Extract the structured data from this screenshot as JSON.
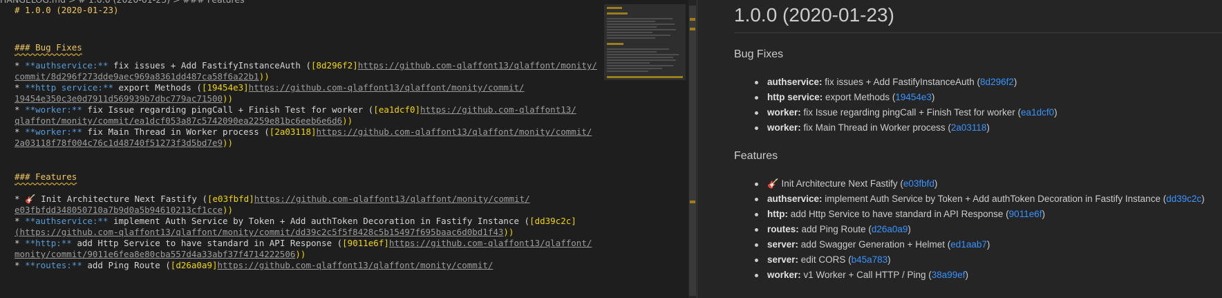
{
  "breadcrumb": "HANGELOG.md > # 1.0.0 (2020-01-23) > ### Features",
  "editor": {
    "h1": "# 1.0.0 (2020-01-23)",
    "bugfix_heading": "### Bug Fixes",
    "features_heading": "### Features",
    "bugfixes": [
      {
        "line1": {
          "bullet": "* ",
          "bold": "**authservice:**",
          "text": " fix issues + Add FastifyInstanceAuth (",
          "link": "[8d296f2]",
          "url": "https://github.com-qlaffont13/qlaffont/monity/"
        },
        "line2": {
          "url": "commit/8d296f273dde9aec969a8361dd487ca58f6a22b1",
          "close": "))"
        }
      },
      {
        "line1": {
          "bullet": "* ",
          "bold": "**http service:**",
          "text": " export Methods (",
          "link": "[19454e3]",
          "url": "https://github.com-qlaffont13/qlaffont/monity/commit/"
        },
        "line2": {
          "url": "19454e350c3e0d7911d569939b7dbc779ac71500",
          "close": "))"
        }
      },
      {
        "line1": {
          "bullet": "* ",
          "bold": "**worker:**",
          "text": " fix Issue regarding pingCall + Finish Test for worker (",
          "link": "[ea1dcf0]",
          "url": "https://github.com-qlaffont13/"
        },
        "line2": {
          "url": "qlaffont/monity/commit/ea1dcf053a87c5742090ea2259e81bc6eeb6e6d6",
          "close": "))"
        }
      },
      {
        "line1": {
          "bullet": "* ",
          "bold": "**worker:**",
          "text": " fix Main Thread in Worker process (",
          "link": "[2a03118]",
          "url": "https://github.com-qlaffont13/qlaffont/monity/commit/"
        },
        "line2": {
          "url": "2a03118f78f004c76c1d48740f51273f3d5bd7e9",
          "close": "))"
        }
      }
    ],
    "features": [
      {
        "line1": {
          "bullet": "* ",
          "bold": "🎸",
          "text": " Init Architecture Next Fastify (",
          "link": "[e03fbfd]",
          "url": "https://github.com-qlaffont13/qlaffont/monity/commit/"
        },
        "line2": {
          "url": "e03fbfdd348050710a7b9d0a5b94610213cf1cce",
          "close": "))"
        }
      },
      {
        "line1": {
          "bullet": "* ",
          "bold": "**authservice:**",
          "text": " implement Auth Service by Token + Add authToken Decoration in Fastify Instance (",
          "link": "[dd39c2c]",
          "url": ""
        },
        "line2": {
          "url": "(https://github.com-qlaffont13/qlaffont/monity/commit/dd39c2c5f5f8428c5b15497f695baac6d0bd1f43",
          "close": "))"
        }
      },
      {
        "line1": {
          "bullet": "* ",
          "bold": "**http:**",
          "text": " add Http Service to have standard in API Response (",
          "link": "[9011e6f]",
          "url": "https://github.com-qlaffont13/qlaffont/"
        },
        "line2": {
          "url": "monity/commit/9011e6fea8e80cba557d4a33abf37f4714222506",
          "close": "))"
        }
      },
      {
        "line1": {
          "bullet": "* ",
          "bold": "**routes:**",
          "text": " add Ping Route (",
          "link": "[d26a0a9]",
          "url": "https://github.com-qlaffont13/qlaffont/monity/commit/"
        },
        "line2": {
          "url": "",
          "close": ""
        }
      }
    ]
  },
  "preview": {
    "title": "1.0.0 (2020-01-23)",
    "bugfix_heading": "Bug Fixes",
    "features_heading": "Features",
    "bugfixes": [
      {
        "scope": "authservice:",
        "text": " fix issues + Add FastifyInstanceAuth (",
        "hash": "8d296f2",
        "close": ")"
      },
      {
        "scope": "http service:",
        "text": " export Methods (",
        "hash": "19454e3",
        "close": ")"
      },
      {
        "scope": "worker:",
        "text": " fix Issue regarding pingCall + Finish Test for worker (",
        "hash": "ea1dcf0",
        "close": ")"
      },
      {
        "scope": "worker:",
        "text": " fix Main Thread in Worker process (",
        "hash": "2a03118",
        "close": ")"
      }
    ],
    "features": [
      {
        "scope": "",
        "text": "🎸 Init Architecture Next Fastify (",
        "hash": "e03fbfd",
        "close": ")"
      },
      {
        "scope": "authservice:",
        "text": " implement Auth Service by Token + Add authToken Decoration in Fastify Instance (",
        "hash": "dd39c2c",
        "close": ")"
      },
      {
        "scope": "http:",
        "text": " add Http Service to have standard in API Response (",
        "hash": "9011e6f",
        "close": ")"
      },
      {
        "scope": "routes:",
        "text": " add Ping Route (",
        "hash": "d26a0a9",
        "close": ")"
      },
      {
        "scope": "server:",
        "text": " add Swagger Generation + Helmet (",
        "hash": "ed1aab7",
        "close": ")"
      },
      {
        "scope": "server:",
        "text": " edit CORS (",
        "hash": "b45a783",
        "close": ")"
      },
      {
        "scope": "worker:",
        "text": " v1 Worker + Call HTTP / Ping (",
        "hash": "38a99ef",
        "close": ")"
      }
    ]
  },
  "colors": {
    "editor_bg": "#1e1e1e",
    "preview_bg": "#252526",
    "heading": "#f3c85b",
    "bold_scope": "#569cd6",
    "link_text": "#ce9178",
    "bracket": "#f1d700",
    "paren": "#da70d6",
    "preview_link": "#3794ff"
  }
}
